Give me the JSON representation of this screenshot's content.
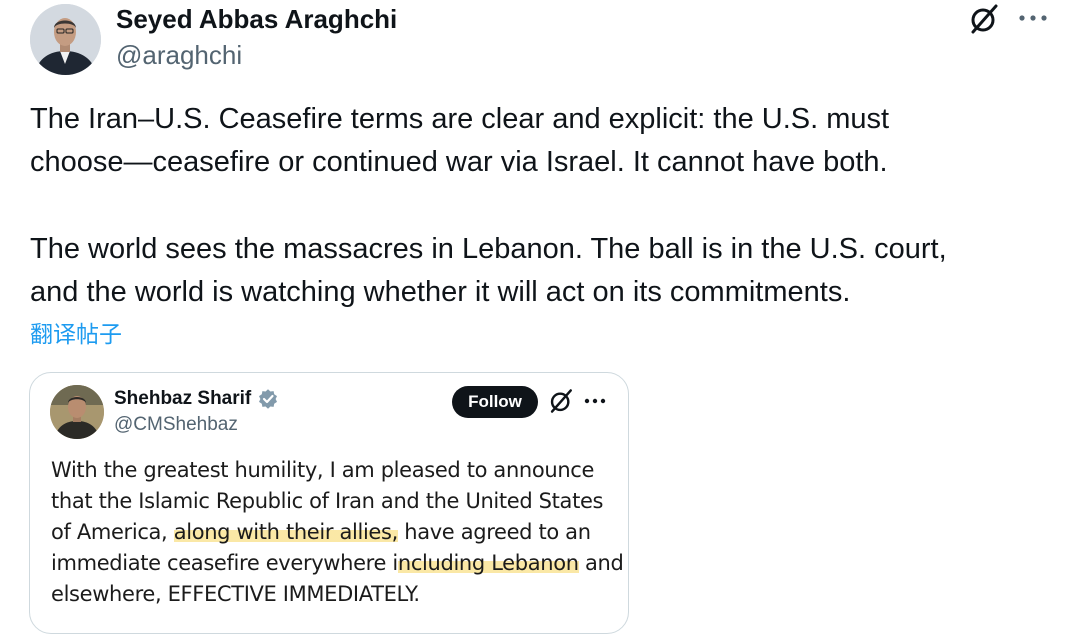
{
  "post": {
    "author_name": "Seyed Abbas Araghchi",
    "author_handle": "@araghchi",
    "paragraph1_line1": "The Iran–U.S. Ceasefire terms are clear and explicit: the U.S. must",
    "paragraph1_line2": "choose—ceasefire or continued war via Israel. It cannot have both.",
    "paragraph2_line1": "The world sees the massacres in Lebanon. The ball is in the U.S. court,",
    "paragraph2_line2": "and the world is watching whether it will act on its commitments.",
    "translate_label": "翻译帖子",
    "icons": {
      "grok": "grok-icon",
      "more": "more-icon"
    }
  },
  "quote": {
    "author_name": "Shehbaz Sharif",
    "author_handle": "@CMShehbaz",
    "verified": true,
    "follow_label": "Follow",
    "lines": [
      [
        "With the greatest humility, I am pleased to announce"
      ],
      [
        "that the Islamic Republic of Iran and the United States"
      ],
      [
        "of America, ",
        "along with their allies,",
        " have agreed to an"
      ],
      [
        "immediate ceasefire everywhere i",
        "ncluding Lebanon",
        " and"
      ],
      [
        "elsewhere, EFFECTIVE IMMEDIATELY."
      ]
    ],
    "highlight_color": "#f7d65c",
    "icons": {
      "verified": "verified-badge-icon",
      "grok": "grok-icon",
      "more": "more-icon"
    }
  },
  "colors": {
    "link": "#1d9bf0",
    "secondary_text": "#536471",
    "verified": "#829aab"
  }
}
